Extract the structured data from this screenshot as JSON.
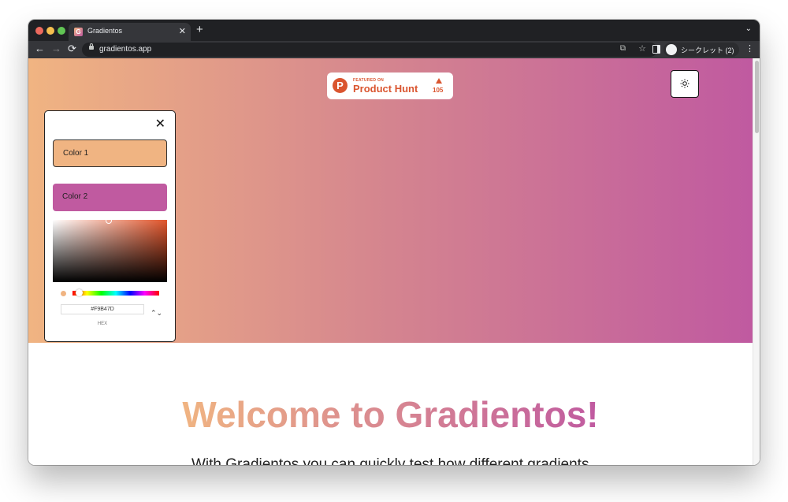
{
  "browser": {
    "tab_title": "Gradientos",
    "favicon_letter": "G",
    "tab_close": "✕",
    "new_tab": "+",
    "tab_menu": "⌄",
    "url": "gradientos.app",
    "back": "←",
    "forward": "→",
    "reload": "⟳",
    "translate": "⧉",
    "bookmark": "☆",
    "profile_label": "シークレット (2)",
    "menu": "⋮"
  },
  "product_hunt": {
    "featured": "FEATURED ON",
    "name": "Product Hunt",
    "logo_letter": "P",
    "votes": "105"
  },
  "picker": {
    "close": "✕",
    "color1_label": "Color 1",
    "color2_label": "Color 2",
    "hex_value": "#F9B47D",
    "hex_label": "HEX",
    "format_toggle": "⌃⌄"
  },
  "colors": {
    "color1": "#F0B482",
    "color2": "#C05AA0",
    "product_hunt": "#DA552F"
  },
  "content": {
    "title": "Welcome to Gradientos!",
    "intro": "With Gradientos you can quickly test how different gradients"
  }
}
